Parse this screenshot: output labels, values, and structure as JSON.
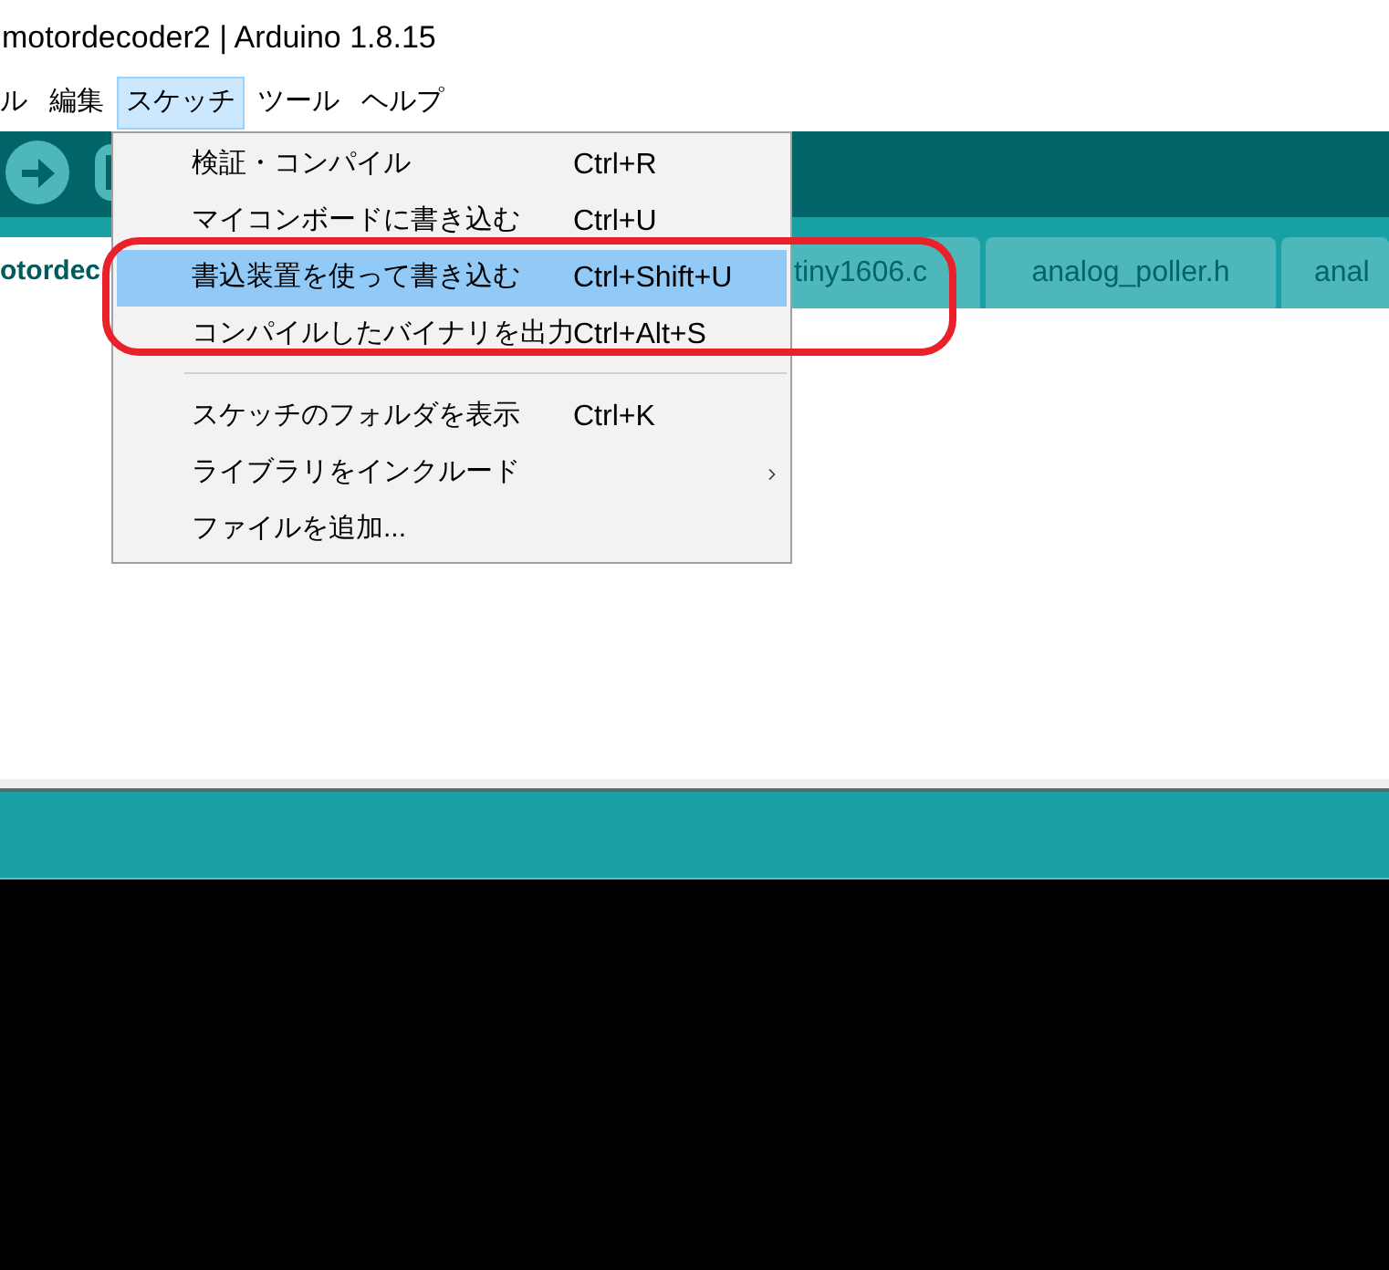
{
  "window": {
    "title": "motordecoder2 | Arduino 1.8.15"
  },
  "menu_bar": [
    {
      "label": "ル",
      "selected": false
    },
    {
      "label": "編集",
      "selected": false
    },
    {
      "label": "スケッチ",
      "selected": true
    },
    {
      "label": "ツール",
      "selected": false
    },
    {
      "label": "ヘルプ",
      "selected": false
    }
  ],
  "tabs": [
    {
      "label": "otordec",
      "selected": true
    },
    {
      "label": "tiny1606.c",
      "selected": false
    },
    {
      "label": "analog_poller.h",
      "selected": false
    },
    {
      "label": "anal",
      "selected": false
    }
  ],
  "sketch_menu": {
    "items": [
      {
        "kind": "item",
        "label": "検証・コンパイル",
        "shortcut": "Ctrl+R",
        "selected": false,
        "submenu": false
      },
      {
        "kind": "item",
        "label": "マイコンボードに書き込む",
        "shortcut": "Ctrl+U",
        "selected": false,
        "submenu": false
      },
      {
        "kind": "item",
        "label": "書込装置を使って書き込む",
        "shortcut": "Ctrl+Shift+U",
        "selected": true,
        "submenu": false
      },
      {
        "kind": "item",
        "label": "コンパイルしたバイナリを出力",
        "shortcut": "Ctrl+Alt+S",
        "selected": false,
        "submenu": false
      },
      {
        "kind": "separator"
      },
      {
        "kind": "item",
        "label": "スケッチのフォルダを表示",
        "shortcut": "Ctrl+K",
        "selected": false,
        "submenu": false
      },
      {
        "kind": "item",
        "label": "ライブラリをインクルード",
        "selected": false,
        "submenu": true
      },
      {
        "kind": "item",
        "label": "ファイルを追加...",
        "selected": false,
        "submenu": false
      }
    ]
  }
}
